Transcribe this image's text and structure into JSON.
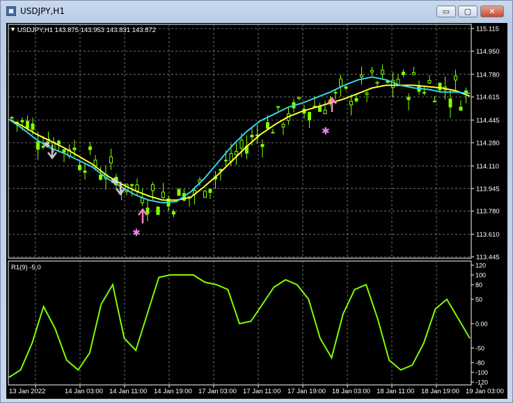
{
  "window": {
    "title": "USDJPY,H1",
    "buttons": {
      "minimize": "▭",
      "maximize": "▢",
      "close": "✕"
    }
  },
  "main_chart": {
    "header": "USDJPY,H1  143.875 143.953 143.831 143.872",
    "price_labels": [
      "115.115",
      "114.950",
      "114.780",
      "114.615",
      "114.445",
      "114.280",
      "114.110",
      "113.945",
      "113.780",
      "113.610",
      "113.445"
    ]
  },
  "indicator": {
    "header": "R1(9) -5.0",
    "scale_labels": [
      "120",
      "100",
      "80",
      "50",
      "0.00",
      "-50",
      "-80",
      "-100",
      "-120"
    ]
  },
  "time_axis": [
    "13 Jan 2022",
    "14 Jan 03:00",
    "14 Jan 11:00",
    "14 Jan 19:00",
    "17 Jan 03:00",
    "17 Jan 11:00",
    "17 Jan 19:00",
    "18 Jan 03:00",
    "18 Jan 11:00",
    "18 Jan 19:00",
    "19 Jan 03:00"
  ],
  "colors": {
    "background": "#000000",
    "grid": "#8a8a8a",
    "candle": "#7fff00",
    "ma_fast": "#33d6e8",
    "ma_slow": "#ffff33",
    "oscillator": "#7fff00",
    "arrow_down": "#c8c8c8",
    "arrow_up": "#ff80c0",
    "star_pink": "#ee82ee",
    "star_grey": "#d0d0d0"
  },
  "chart_data": {
    "type": "line",
    "series": [
      {
        "values": [
          114.45,
          114.38,
          114.3,
          114.24,
          114.2,
          114.15,
          114.1,
          114.02,
          113.96,
          113.9,
          113.86,
          113.84,
          113.85,
          113.92,
          114.02,
          114.14,
          114.26,
          114.36,
          114.44,
          114.49,
          114.54,
          114.57,
          114.61,
          114.65,
          114.7,
          114.74,
          114.76,
          114.74,
          114.7,
          114.68,
          114.67,
          114.65,
          114.65,
          114.64
        ]
      },
      {
        "values": [
          114.45,
          114.4,
          114.34,
          114.29,
          114.24,
          114.18,
          114.12,
          114.04,
          113.98,
          113.93,
          113.89,
          113.86,
          113.86,
          113.88,
          113.96,
          114.05,
          114.15,
          114.25,
          114.34,
          114.41,
          114.47,
          114.51,
          114.54,
          114.57,
          114.6,
          114.64,
          114.68,
          114.7,
          114.7,
          114.7,
          114.69,
          114.68,
          114.66,
          114.62
        ]
      },
      {
        "values": [
          -110,
          -95,
          -40,
          35,
          -10,
          -75,
          -95,
          -60,
          40,
          80,
          -30,
          -55,
          20,
          95,
          100,
          100,
          100,
          85,
          80,
          70,
          0,
          5,
          40,
          75,
          90,
          80,
          50,
          -30,
          -70,
          20,
          70,
          80,
          10,
          -75,
          -95,
          -85,
          -40,
          30,
          50,
          10,
          -30
        ]
      }
    ]
  }
}
